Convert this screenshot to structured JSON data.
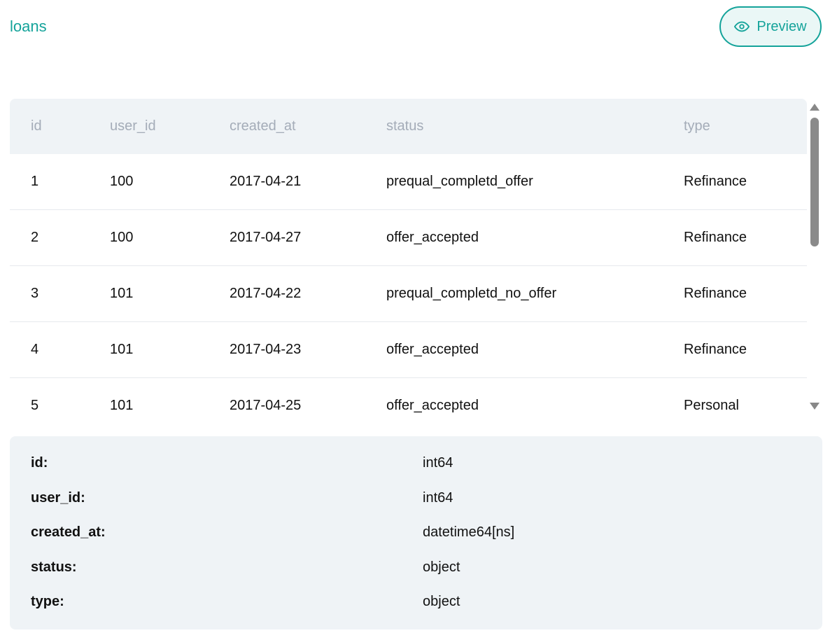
{
  "header": {
    "title": "loans",
    "preview_label": "Preview",
    "preview_icon": "eye-icon"
  },
  "table": {
    "columns": [
      "id",
      "user_id",
      "created_at",
      "status",
      "type"
    ],
    "rows": [
      [
        "1",
        "100",
        "2017-04-21",
        "prequal_completd_offer",
        "Refinance"
      ],
      [
        "2",
        "100",
        "2017-04-27",
        "offer_accepted",
        "Refinance"
      ],
      [
        "3",
        "101",
        "2017-04-22",
        "prequal_completd_no_offer",
        "Refinance"
      ],
      [
        "4",
        "101",
        "2017-04-23",
        "offer_accepted",
        "Refinance"
      ],
      [
        "5",
        "101",
        "2017-04-25",
        "offer_accepted",
        "Personal"
      ]
    ]
  },
  "schema": [
    {
      "key": "id:",
      "dtype": "int64"
    },
    {
      "key": "user_id:",
      "dtype": "int64"
    },
    {
      "key": "created_at:",
      "dtype": "datetime64[ns]"
    },
    {
      "key": "status:",
      "dtype": "object"
    },
    {
      "key": "type:",
      "dtype": "object"
    }
  ],
  "colors": {
    "accent": "#14a39a",
    "panel": "#eff3f6",
    "header_text": "#a4acb8"
  }
}
